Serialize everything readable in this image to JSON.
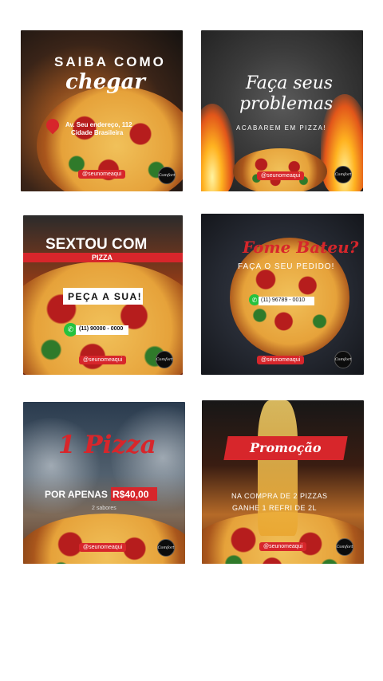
{
  "cards": [
    {
      "title": "SAIBA COMO",
      "subtitle": "chegar",
      "address_line1": "Av. Seu endereço, 112",
      "address_line2": "Cidade Brasileira",
      "handle": "@seunomeaqui",
      "logo": "Comfort"
    },
    {
      "title_line1": "Faça seus",
      "title_line2": "problemas",
      "subtitle": "ACABAREM EM PIZZA!",
      "handle": "@seunomeaqui",
      "logo": "Comfort"
    },
    {
      "title": "SEXTOU COM",
      "banner": "PIZZA",
      "cta": "PEÇA A SUA!",
      "phone": "(11) 90000 - 0000",
      "handle": "@seunomeaqui",
      "logo": "Comfort"
    },
    {
      "title": "Fome Bateu?",
      "subtitle": "FAÇA O SEU PEDIDO!",
      "phone": "(11) 96789 - 0010",
      "handle": "@seunomeaqui",
      "logo": "Comfort"
    },
    {
      "title": "1 Pizza",
      "price_prefix": "POR APENAS",
      "price": "R$40,00",
      "note": "2 sabores",
      "handle": "@seunomeaqui",
      "logo": "Comfort"
    },
    {
      "banner": "Promoção",
      "line1": "NA COMPRA DE 2 PIZZAS",
      "line2": "GANHE 1 REFRI DE 2L",
      "handle": "@seunomeaqui",
      "logo": "Comfort"
    }
  ],
  "colors": {
    "accent_red": "#d7262b",
    "whatsapp_green": "#25c23e"
  },
  "icons": [
    "location-pin-icon",
    "whatsapp-icon",
    "logo-badge"
  ]
}
